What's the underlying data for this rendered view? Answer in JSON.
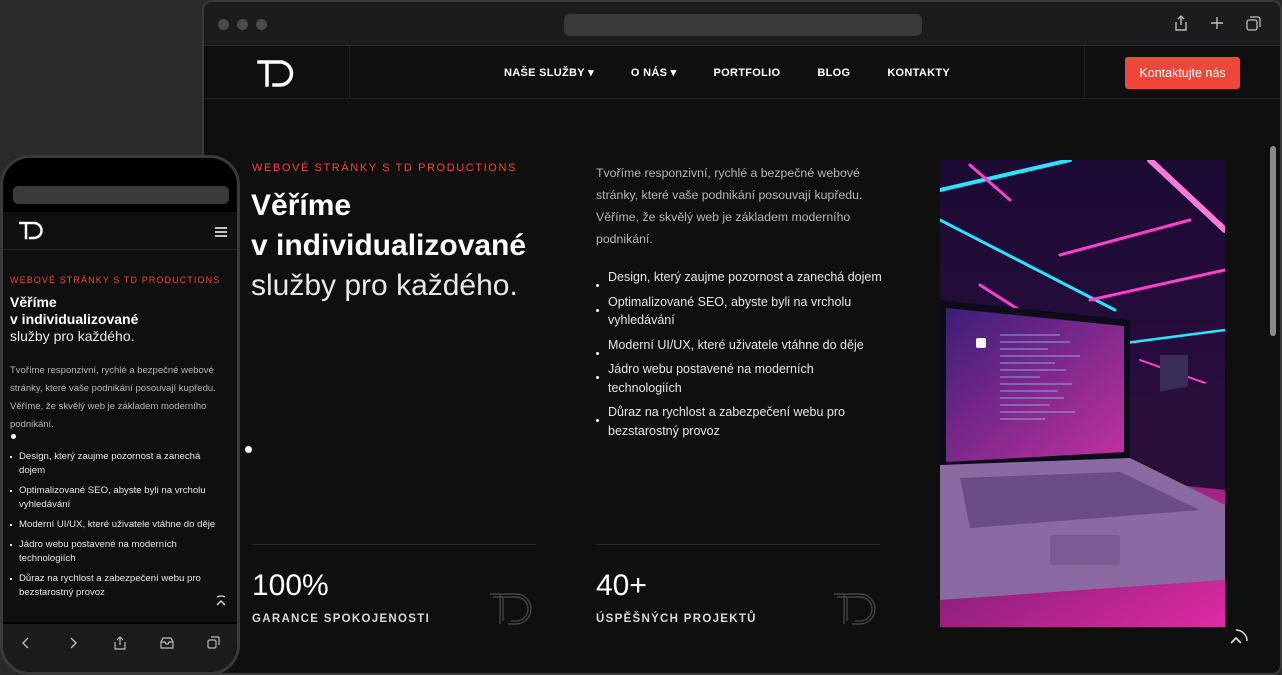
{
  "nav": {
    "items": [
      "NAŠE SLUŽBY",
      "O NÁS",
      "PORTFOLIO",
      "BLOG",
      "KONTAKTY"
    ],
    "dropdown_caret": "▾",
    "cta": "Kontaktujte nás"
  },
  "hero": {
    "kicker": "WEBOVÉ STRÁNKY S TD PRODUCTIONS",
    "title_line1": "Věříme",
    "title_line2": "v individualizované",
    "title_line3": "služby pro každého.",
    "intro": "Tvoříme responzivní, rychlé a bezpečné webové stránky, které vaše podnikání posouvají kupředu. Věříme, že skvělý web je základem moderního podnikání.",
    "features": [
      "Design, který zaujme pozornost a zanechá dojem",
      "Optimalizované SEO, abyste byli na vrcholu vyhledávání",
      "Moderní UI/UX, které uživatele vtáhne do děje",
      "Jádro webu postavené na moderních technologiích",
      "Důraz na rychlost a zabezpečení webu pro bezstarostný provoz"
    ]
  },
  "stats": [
    {
      "value": "100%",
      "label": "GARANCE SPOKOJENOSTI"
    },
    {
      "value": "40+",
      "label": "ÚSPĚŠNÝCH PROJEKTŮ"
    }
  ],
  "icons": {
    "share": "share-icon",
    "new_tab": "plus-icon",
    "tabs": "tabs-icon",
    "menu": "hamburger-icon",
    "back_to_top": "chevron-up-icon"
  },
  "colors": {
    "accent": "#f0473a",
    "background": "#0f0f10",
    "frame": "#2a2a2c"
  }
}
